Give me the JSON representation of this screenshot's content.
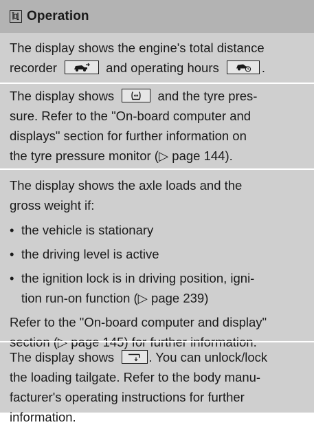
{
  "header": {
    "title": "Operation",
    "icon": "operation-icon"
  },
  "sections": [
    {
      "lines": [
        {
          "text": "The display shows the engine's total distance"
        },
        {
          "before": "recorder",
          "icon1": "distance-recorder-icon",
          "middle": "and operating hours",
          "icon2": "operating-hours-icon",
          "after": "."
        }
      ]
    },
    {
      "lines": [
        {
          "before": "The display shows",
          "icon": "tyre-pressure-icon",
          "after": "and the tyre pres-"
        },
        {
          "text": "sure. Refer to the \"On-board computer and"
        },
        {
          "text": "displays\" section for further information on"
        },
        {
          "text": "the tyre pressure monitor (▷ page 144)."
        }
      ]
    },
    {
      "lines": [
        {
          "text": "The display shows the axle loads and the"
        },
        {
          "text": "gross weight if:"
        }
      ],
      "bullet_symbol": "•",
      "bullets": [
        {
          "lines": [
            "the vehicle is stationary"
          ]
        },
        {
          "lines": [
            "the driving level is active"
          ]
        },
        {
          "lines": [
            "the ignition lock is in driving position, igni-",
            "tion run-on function (▷ page 239)"
          ]
        }
      ],
      "footer_lines": [
        "Refer to the \"On-board computer and display\"",
        "section (▷ page 145) for further information."
      ]
    },
    {
      "lines": [
        {
          "before": "The display shows",
          "icon": "loading-tailgate-icon",
          "after": ". You can unlock/lock"
        },
        {
          "text": "the loading tailgate. Refer to the body manu-"
        },
        {
          "text": "facturer's operating instructions for further"
        },
        {
          "text": "information."
        }
      ]
    }
  ]
}
